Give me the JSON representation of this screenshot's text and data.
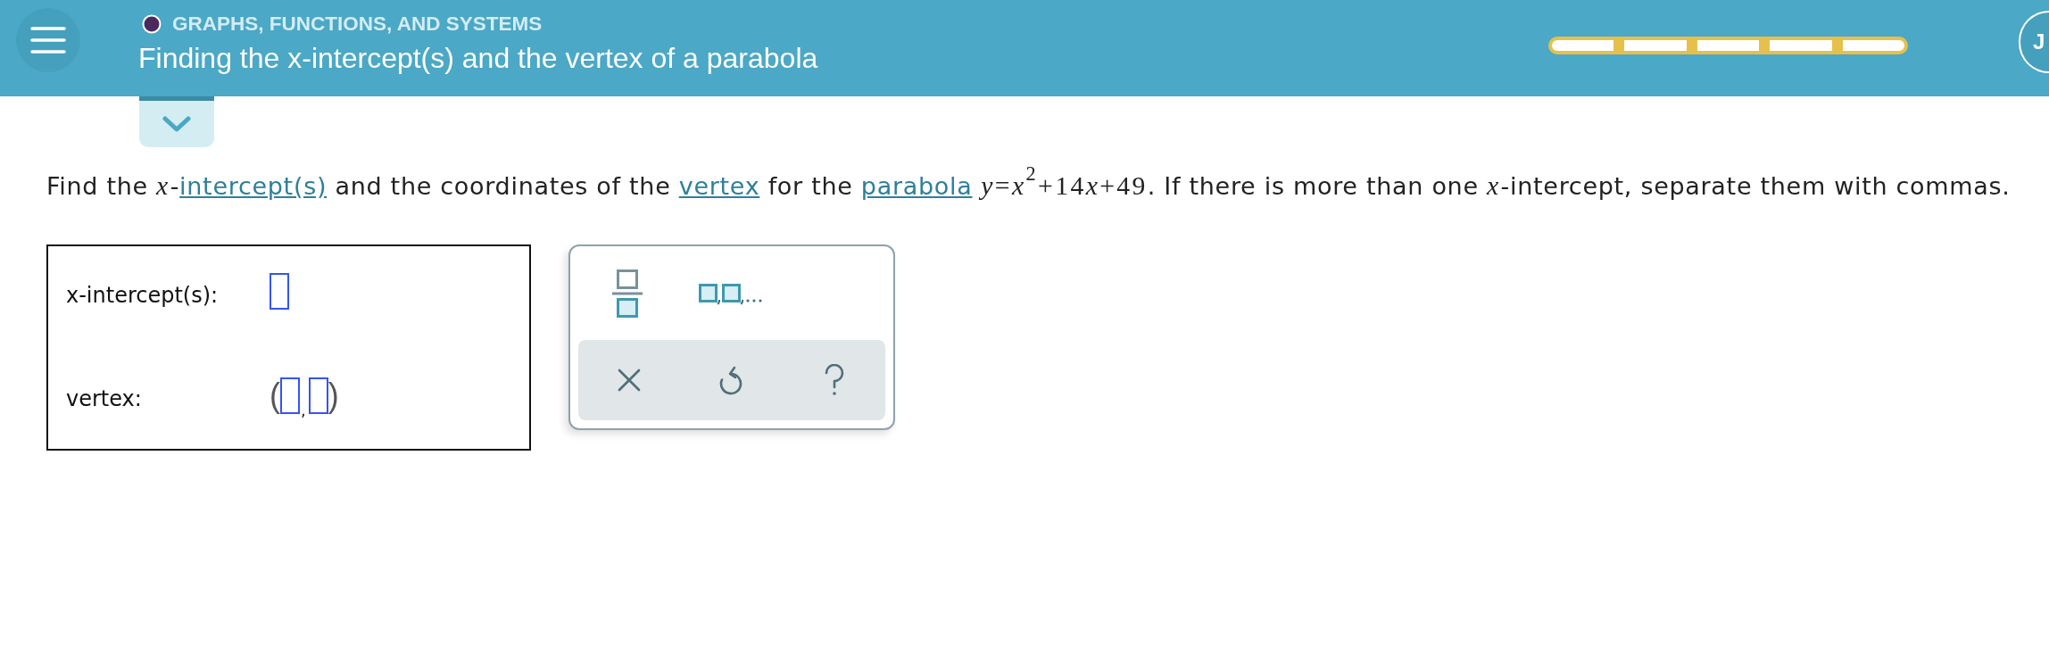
{
  "header": {
    "topic": "GRAPHS, FUNCTIONS, AND SYSTEMS",
    "title": "Finding the x-intercept(s) and the vertex of a parabola",
    "progress": {
      "segments": [
        {
          "filled": false
        },
        {
          "filled": false
        },
        {
          "filled": false
        },
        {
          "filled": false
        },
        {
          "filled": false
        }
      ]
    },
    "user": {
      "initial": "J"
    }
  },
  "details_toggle": {
    "expanded": false
  },
  "question": {
    "parts": [
      {
        "kind": "text",
        "text": "Find the "
      },
      {
        "kind": "math",
        "text": "*x*"
      },
      {
        "kind": "text",
        "text": "-"
      },
      {
        "kind": "link",
        "text": "intercept(s)"
      },
      {
        "kind": "text",
        "text": " and the coordinates of the "
      },
      {
        "kind": "link",
        "text": "vertex"
      },
      {
        "kind": "text",
        "text": " for the "
      },
      {
        "kind": "link",
        "text": "parabola"
      },
      {
        "kind": "math",
        "text": " *y*=*x*$^{2}$+14"
      },
      {
        "kind": "math",
        "text": "*x*"
      },
      {
        "kind": "math",
        "text": "+49"
      },
      {
        "kind": "text",
        "text": ". If there is more than one "
      },
      {
        "kind": "math",
        "text": "*x*"
      },
      {
        "kind": "text",
        "text": "-intercept, separate them with commas."
      }
    ]
  },
  "answer": {
    "rows": [
      {
        "kind": "single",
        "label": "x-intercept(s):"
      },
      {
        "kind": "ordered_pair",
        "label": "vertex:",
        "open": "(",
        "separator": ",",
        "close": ")"
      }
    ]
  },
  "keypad": {
    "keys": [
      {
        "kind": "fraction"
      },
      {
        "kind": "list"
      }
    ],
    "actions": [
      {
        "kind": "clear"
      },
      {
        "kind": "undo"
      },
      {
        "kind": "help"
      }
    ]
  }
}
